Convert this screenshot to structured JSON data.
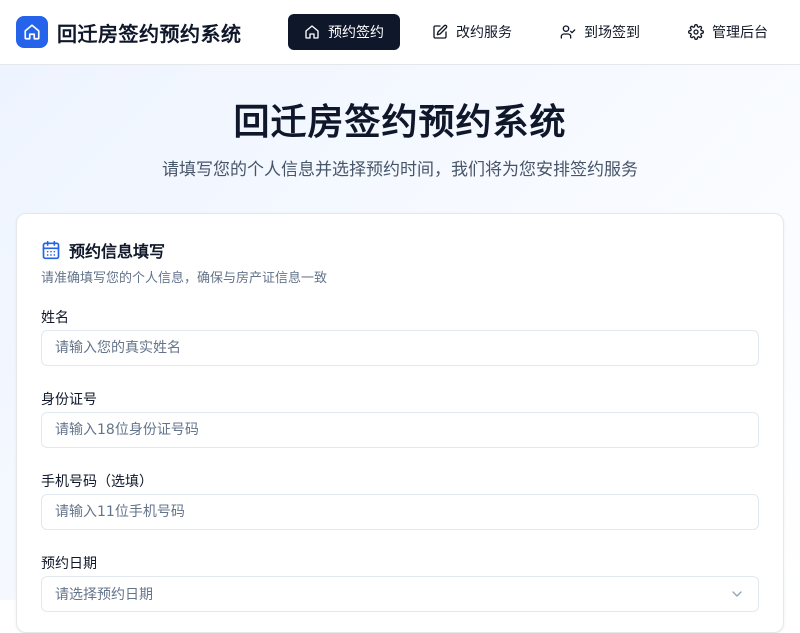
{
  "app": {
    "title": "回迁房签约预约系统",
    "logo_icon": "home-icon",
    "accent": "#2563eb"
  },
  "nav": {
    "items": [
      {
        "label": "预约签约",
        "icon": "home-icon",
        "active": true
      },
      {
        "label": "改约服务",
        "icon": "edit-icon",
        "active": false
      },
      {
        "label": "到场签到",
        "icon": "user-check-icon",
        "active": false
      },
      {
        "label": "管理后台",
        "icon": "settings-icon",
        "active": false
      }
    ]
  },
  "hero": {
    "title": "回迁房签约预约系统",
    "subtitle": "请填写您的个人信息并选择预约时间，我们将为您安排签约服务"
  },
  "form": {
    "title": "预约信息填写",
    "title_icon": "calendar-icon",
    "description": "请准确填写您的个人信息，确保与房产证信息一致",
    "fields": [
      {
        "label": "姓名",
        "placeholder": "请输入您的真实姓名",
        "value": ""
      },
      {
        "label": "身份证号",
        "placeholder": "请输入18位身份证号码",
        "value": ""
      },
      {
        "label": "手机号码（选填）",
        "placeholder": "请输入11位手机号码",
        "value": ""
      },
      {
        "label": "预约日期",
        "placeholder": "请选择预约日期",
        "value": "",
        "type": "select",
        "icon": "chevron-down-icon"
      }
    ]
  }
}
